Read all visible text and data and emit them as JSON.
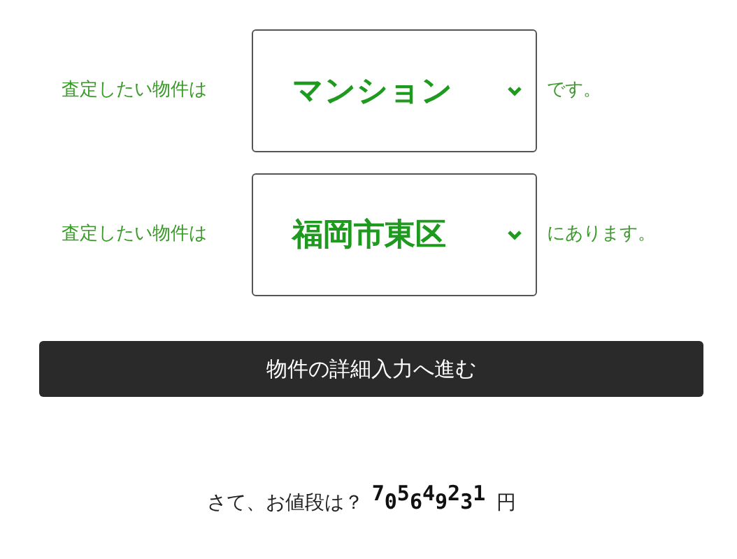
{
  "rows": [
    {
      "prefix": "査定したい物件は",
      "value": "マンション",
      "suffix": "です。"
    },
    {
      "prefix": "査定したい物件は",
      "value": "福岡市東区",
      "suffix": "にあります。"
    }
  ],
  "submit_button": "物件の詳細入力へ進む",
  "price": {
    "label": "さて、お値段は？",
    "digits": [
      "7",
      "0",
      "5",
      "6",
      "4",
      "9",
      "2",
      "3",
      "1"
    ],
    "unit": "円"
  }
}
